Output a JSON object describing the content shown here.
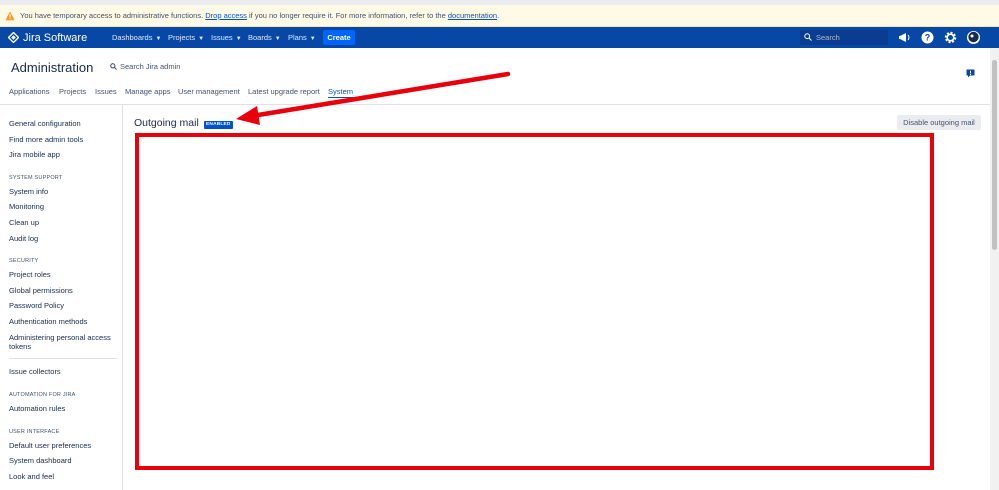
{
  "banner": {
    "text_before": "You have temporary access to administrative functions. ",
    "link_drop": "Drop access",
    "text_middle": " if you no longer require it. For more information, refer to the ",
    "link_doc": "documentation",
    "text_after": "."
  },
  "navbar": {
    "logo": "Jira Software",
    "items": [
      "Dashboards",
      "Projects",
      "Issues",
      "Boards",
      "Plans"
    ],
    "create": "Create",
    "search_placeholder": "Search",
    "icons": [
      "megaphone-icon",
      "help-icon",
      "gear-icon",
      "user-avatar-icon"
    ]
  },
  "admin": {
    "title": "Administration",
    "search": "Search Jira admin",
    "tabs": [
      "Applications",
      "Projects",
      "Issues",
      "Manage apps",
      "User management",
      "Latest upgrade report",
      "System"
    ],
    "active_tab": "System"
  },
  "sidebar": {
    "top_items": [
      "General configuration",
      "Find more admin tools",
      "Jira mobile app"
    ],
    "system_support": {
      "heading": "SYSTEM SUPPORT",
      "items": [
        "System info",
        "Monitoring",
        "Clean up",
        "Audit log"
      ]
    },
    "security": {
      "heading": "SECURITY",
      "items": [
        "Project roles",
        "Global permissions",
        "Password Policy",
        "Authentication methods",
        "Administering personal access tokens"
      ]
    },
    "misc_items": [
      "Issue collectors"
    ],
    "automation": {
      "heading": "AUTOMATION FOR JIRA",
      "items": [
        "Automation rules"
      ]
    },
    "user_interface": {
      "heading": "USER INTERFACE",
      "items": [
        "Default user preferences",
        "System dashboard",
        "Look and feel"
      ]
    }
  },
  "main": {
    "title": "Outgoing mail",
    "status": "ENABLED",
    "disable_button": "Disable outgoing mail"
  },
  "colors": {
    "nav_bg": "#0747a6",
    "accent": "#0052cc",
    "annotation_red": "#e8000b",
    "banner_bg": "#fffae6"
  }
}
